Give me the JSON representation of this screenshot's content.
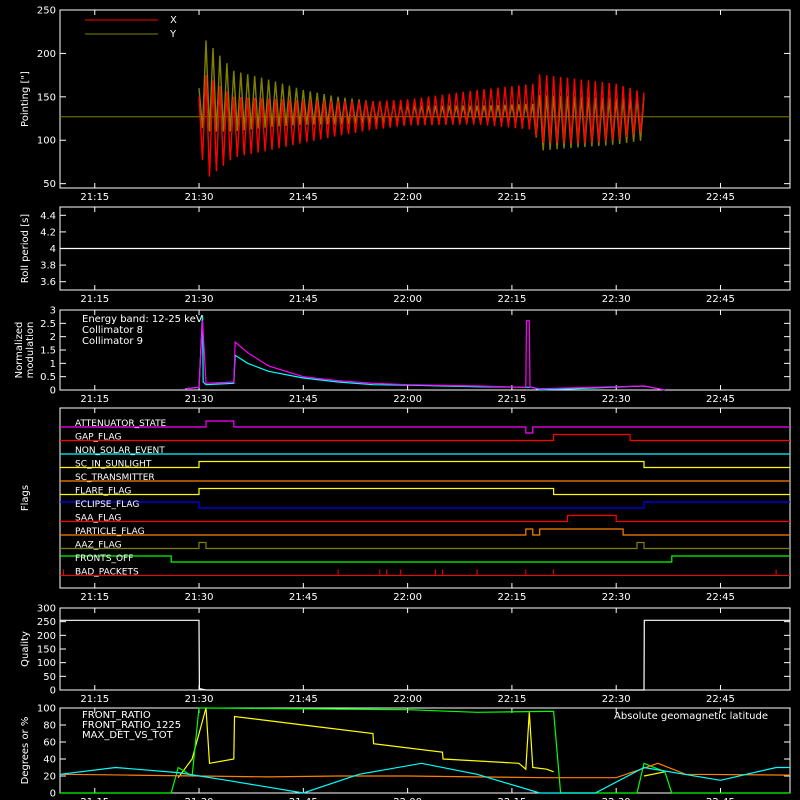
{
  "time_axis": {
    "range": [
      "21:10",
      "22:55"
    ],
    "ticks": [
      "21:15",
      "21:30",
      "21:45",
      "22:00",
      "22:15",
      "22:30",
      "22:45"
    ]
  },
  "chart_data": [
    {
      "id": "pointing",
      "type": "line",
      "ylabel": "Pointing [\"]",
      "ylim": [
        45,
        250
      ],
      "yticks": [
        50,
        100,
        150,
        200,
        250
      ],
      "reference_line": 127,
      "series": [
        {
          "name": "X",
          "color": "#ff0000",
          "envelope": {
            "t": [
              "21:30",
              "21:31",
              "21:35",
              "21:40",
              "21:45",
              "21:50",
              "21:55",
              "22:00",
              "22:10",
              "22:18",
              "22:19",
              "22:25",
              "22:30",
              "22:34"
            ],
            "upper": [
              150,
              175,
              150,
              148,
              146,
              145,
              145,
              147,
              158,
              165,
              176,
              170,
              165,
              155
            ],
            "lower": [
              100,
              55,
              80,
              88,
              97,
              105,
              112,
              117,
              118,
              112,
              97,
              96,
              100,
              110
            ]
          }
        },
        {
          "name": "Y",
          "color": "#808000",
          "envelope": {
            "t": [
              "21:30",
              "21:31",
              "21:35",
              "21:40",
              "21:45",
              "21:50",
              "21:55",
              "22:00",
              "22:10",
              "22:18",
              "22:19",
              "22:25",
              "22:30",
              "22:34"
            ],
            "upper": [
              160,
              215,
              180,
              170,
              158,
              150,
              145,
              140,
              140,
              142,
              152,
              150,
              148,
              150
            ],
            "lower": [
              118,
              110,
              110,
              115,
              118,
              118,
              120,
              120,
              120,
              118,
              88,
              92,
              95,
              100
            ]
          }
        }
      ]
    },
    {
      "id": "roll",
      "type": "line",
      "ylabel": "Roll period [s]",
      "ylim": [
        3.5,
        4.5
      ],
      "yticks": [
        3.6,
        3.8,
        4.0,
        4.2,
        4.4
      ],
      "series": [
        {
          "name": "",
          "color": "#ffffff",
          "x": [
            "21:10",
            "22:55"
          ],
          "y": [
            4.0,
            4.0
          ]
        }
      ]
    },
    {
      "id": "modulation",
      "type": "line",
      "ylabel": [
        "Normalized",
        "modulation"
      ],
      "ylim": [
        0,
        3.0
      ],
      "yticks": [
        0.0,
        0.5,
        1.0,
        1.5,
        2.0,
        2.5,
        3.0
      ],
      "annotation": "Energy band: 12-25 keV",
      "series": [
        {
          "name": "Collimator 8",
          "color": "#00ffff",
          "x": [
            "21:28",
            "21:30",
            "21:30.5",
            "21:30.6",
            "21:31",
            "21:35",
            "21:35.2",
            "21:37",
            "21:40",
            "21:45",
            "21:50",
            "21:55",
            "22:00",
            "22:10",
            "22:18",
            "22:19",
            "22:34",
            "22:35",
            "22:37"
          ],
          "y": [
            0.05,
            0.1,
            2.8,
            0.3,
            0.2,
            0.25,
            1.3,
            1.0,
            0.7,
            0.45,
            0.3,
            0.2,
            0.18,
            0.12,
            0.1,
            0,
            0.15,
            0.1,
            0
          ]
        },
        {
          "name": "Collimator 9",
          "color": "#ff00ff",
          "x": [
            "21:28",
            "21:30",
            "21:30.5",
            "21:31",
            "21:35",
            "21:35.2",
            "21:37",
            "21:40",
            "21:45",
            "21:50",
            "21:55",
            "22:00",
            "22:10",
            "22:17",
            "22:17.1",
            "22:17.5",
            "22:17.6",
            "22:19",
            "22:34",
            "22:35",
            "22:37"
          ],
          "y": [
            0.05,
            0.1,
            2.6,
            0.25,
            0.3,
            1.8,
            1.4,
            0.9,
            0.5,
            0.35,
            0.25,
            0.2,
            0.15,
            0.1,
            2.6,
            2.6,
            0.1,
            0.05,
            0.15,
            0.1,
            0
          ]
        }
      ]
    },
    {
      "id": "flags",
      "type": "step",
      "ylabel": "Flags",
      "flags": [
        {
          "name": "ATTENUATOR_STATE",
          "color": "#ff00ff",
          "segments": [
            [
              "21:10",
              "21:31",
              0
            ],
            [
              "21:31",
              "21:35",
              1
            ],
            [
              "21:35",
              "22:17",
              0
            ],
            [
              "22:17",
              "22:18",
              -1
            ],
            [
              "22:18",
              "22:55",
              0
            ]
          ]
        },
        {
          "name": "GAP_FLAG",
          "color": "#ff0000",
          "segments": [
            [
              "21:10",
              "22:21",
              0
            ],
            [
              "22:21",
              "22:32",
              1
            ],
            [
              "22:32",
              "22:55",
              0
            ]
          ]
        },
        {
          "name": "NON_SOLAR_EVENT",
          "color": "#00ffff",
          "segments": [
            [
              "21:10",
              "22:55",
              0
            ]
          ]
        },
        {
          "name": "SC_IN_SUNLIGHT",
          "color": "#ffff00",
          "segments": [
            [
              "21:10",
              "21:30",
              0
            ],
            [
              "21:30",
              "22:34",
              1
            ],
            [
              "22:34",
              "22:55",
              0
            ]
          ]
        },
        {
          "name": "SC_TRANSMITTER",
          "color": "#ff7f00",
          "segments": [
            [
              "21:10",
              "22:55",
              0
            ]
          ]
        },
        {
          "name": "FLARE_FLAG",
          "color": "#ffff00",
          "segments": [
            [
              "21:10",
              "21:30",
              0
            ],
            [
              "21:30",
              "22:21",
              1
            ],
            [
              "22:21",
              "22:55",
              0
            ]
          ]
        },
        {
          "name": "ECLIPSE_FLAG",
          "color": "#0000ff",
          "segments": [
            [
              "21:10",
              "21:30",
              1
            ],
            [
              "21:30",
              "22:34",
              0
            ],
            [
              "22:34",
              "22:55",
              1
            ]
          ]
        },
        {
          "name": "SAA_FLAG",
          "color": "#ff0000",
          "segments": [
            [
              "21:10",
              "22:23",
              0
            ],
            [
              "22:23",
              "22:30",
              1
            ],
            [
              "22:30",
              "22:55",
              0
            ]
          ]
        },
        {
          "name": "PARTICLE_FLAG",
          "color": "#ff7f00",
          "segments": [
            [
              "21:10",
              "22:17",
              0
            ],
            [
              "22:17",
              "22:18",
              1
            ],
            [
              "22:18",
              "22:19",
              0
            ],
            [
              "22:19",
              "22:31",
              1
            ],
            [
              "22:31",
              "22:55",
              0
            ]
          ]
        },
        {
          "name": "AAZ_FLAG",
          "color": "#808000",
          "segments": [
            [
              "21:10",
              "21:30",
              0
            ],
            [
              "21:30",
              "21:31",
              1
            ],
            [
              "21:31",
              "22:33",
              0
            ],
            [
              "22:33",
              "22:34",
              1
            ],
            [
              "22:34",
              "22:55",
              0
            ]
          ]
        },
        {
          "name": "FRONTS_OFF",
          "color": "#00ff00",
          "segments": [
            [
              "21:10",
              "21:26",
              1
            ],
            [
              "21:26",
              "22:38",
              0
            ],
            [
              "22:38",
              "22:55",
              1
            ]
          ]
        },
        {
          "name": "BAD_PACKETS",
          "color": "#ff0000",
          "spikes": [
            "21:10.5",
            "22:05",
            "21:50",
            "21:56",
            "21:57",
            "21:59",
            "22:04",
            "22:10",
            "22:17",
            "22:21",
            "22:53"
          ]
        }
      ]
    },
    {
      "id": "quality",
      "type": "line",
      "ylabel": "Quality",
      "ylim": [
        0,
        300
      ],
      "yticks": [
        0,
        50,
        100,
        150,
        200,
        250,
        300
      ],
      "series": [
        {
          "name": "",
          "color": "#ffffff",
          "x": [
            "21:10",
            "21:30",
            "21:30.05",
            "21:31",
            "22:34",
            "22:34.05",
            "22:55"
          ],
          "y": [
            255,
            255,
            5,
            0,
            0,
            255,
            255
          ]
        }
      ]
    },
    {
      "id": "ratios",
      "type": "line",
      "ylabel": "Degrees or %",
      "ylim": [
        0,
        100
      ],
      "yticks": [
        0,
        20,
        40,
        60,
        80,
        100
      ],
      "annotation": "Absolute geomagnetic latitude",
      "series": [
        {
          "name": "FRONT_RATIO",
          "color": "#ffff00",
          "x": [
            "21:10",
            "21:27",
            "21:29",
            "21:31",
            "21:31.5",
            "21:35",
            "21:35.1",
            "21:45",
            "21:55",
            "21:55.1",
            "22:05",
            "22:05.1",
            "22:16",
            "22:17",
            "22:17.5",
            "22:18",
            "22:20",
            "22:21",
            "22:33",
            "22:34",
            "22:37",
            "22:55"
          ],
          "y": [
            null,
            18,
            40,
            100,
            35,
            40,
            90,
            80,
            70,
            58,
            48,
            40,
            35,
            28,
            95,
            30,
            28,
            25,
            null,
            20,
            25,
            null
          ]
        },
        {
          "name": "FRONT_RATIO_1225",
          "color": "#00ff00",
          "x": [
            "21:10",
            "21:26",
            "21:27",
            "21:29",
            "21:30",
            "21:31",
            "22:00",
            "22:10",
            "22:20",
            "22:21",
            "22:22",
            "22:33",
            "22:34",
            "22:37",
            "22:38",
            "22:55"
          ],
          "y": [
            0,
            0,
            30,
            20,
            100,
            100,
            98,
            95,
            96,
            96,
            0,
            0,
            35,
            25,
            0,
            0
          ]
        },
        {
          "name": "MAX_DET_VS_TOT",
          "color": "#ff8000",
          "x": [
            "21:10",
            "21:20",
            "21:30",
            "21:40",
            "21:50",
            "22:00",
            "22:10",
            "22:20",
            "22:30",
            "22:36",
            "22:40",
            "22:55"
          ],
          "y": [
            22,
            21,
            20,
            19,
            20,
            20,
            19,
            18,
            18,
            35,
            22,
            21
          ]
        },
        {
          "name": "Absolute geomagnetic latitude",
          "color": "#00ffff",
          "x": [
            "21:10",
            "21:18",
            "21:27",
            "21:34",
            "21:45",
            "21:53",
            "22:02",
            "22:10",
            "22:19",
            "22:27",
            "22:34",
            "22:45",
            "22:53",
            "22:55"
          ],
          "y": [
            22,
            30,
            24,
            15,
            0,
            22,
            35,
            22,
            0,
            0,
            30,
            15,
            30,
            30
          ]
        }
      ]
    }
  ]
}
